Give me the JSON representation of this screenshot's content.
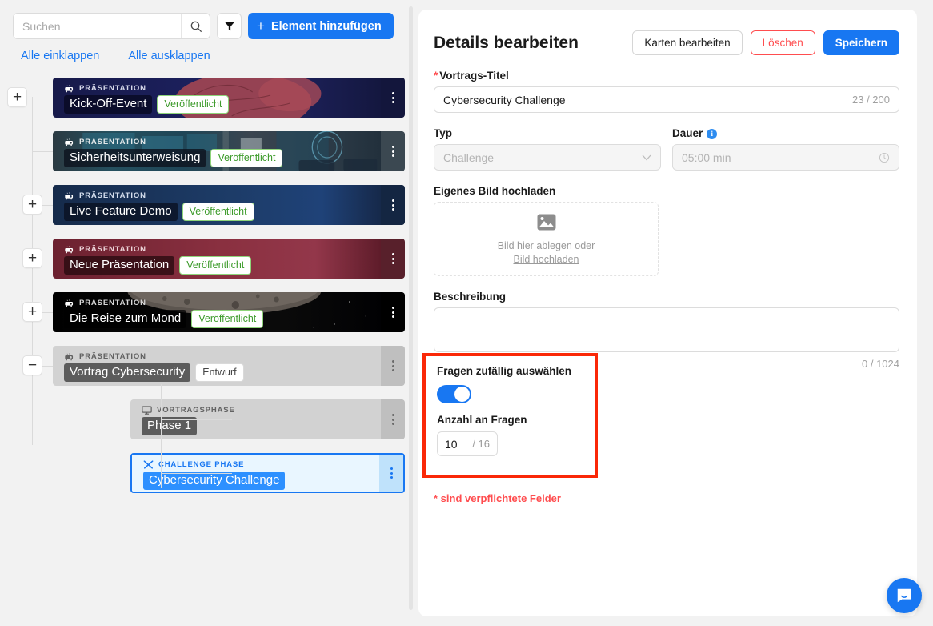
{
  "left": {
    "search": {
      "placeholder": "Suchen",
      "value": "",
      "icon": "search-icon"
    },
    "filter_icon": "filter-icon",
    "add_button": {
      "label": "Element hinzufügen",
      "icon": "plus-icon"
    },
    "collapse_all": "Alle einklappen",
    "expand_all": "Alle ausklappen",
    "tree": [
      {
        "kicker": "PRÄSENTATION",
        "kicker_icon": "projector-icon",
        "title": "Kick-Off-Event",
        "badge": "Veröffentlicht",
        "badge_type": "published",
        "toggle": "+",
        "indent": 0,
        "theme": "dark-blue-brain"
      },
      {
        "kicker": "PRÄSENTATION",
        "kicker_icon": "projector-icon",
        "title": "Sicherheitsunterweisung",
        "badge": "Veröffentlicht",
        "badge_type": "published",
        "toggle": "",
        "indent": 0,
        "theme": "teal-office"
      },
      {
        "kicker": "PRÄSENTATION",
        "kicker_icon": "projector-icon",
        "title": "Live Feature Demo",
        "badge": "Veröffentlicht",
        "badge_type": "published",
        "toggle": "+",
        "indent": 0,
        "theme": "navy"
      },
      {
        "kicker": "PRÄSENTATION",
        "kicker_icon": "projector-icon",
        "title": "Neue Präsentation",
        "badge": "Veröffentlicht",
        "badge_type": "published",
        "toggle": "+",
        "indent": 0,
        "theme": "maroon"
      },
      {
        "kicker": "PRÄSENTATION",
        "kicker_icon": "projector-icon",
        "title": "Die Reise zum Mond",
        "badge": "Veröffentlicht",
        "badge_type": "published",
        "toggle": "+",
        "indent": 0,
        "theme": "moon"
      },
      {
        "kicker": "PRÄSENTATION",
        "kicker_icon": "projector-icon",
        "title": "Vortrag Cybersecurity",
        "badge": "Entwurf",
        "badge_type": "draft",
        "toggle": "−",
        "indent": 0,
        "theme": "grey"
      },
      {
        "kicker": "VORTRAGSPHASE",
        "kicker_icon": "monitor-icon",
        "title": "Phase 1",
        "badge": "",
        "badge_type": "none",
        "toggle": "",
        "indent": 1,
        "theme": "grey"
      },
      {
        "kicker": "CHALLENGE PHASE",
        "kicker_icon": "crossed-swords-icon",
        "title": "Cybersecurity Challenge",
        "badge": "",
        "badge_type": "none",
        "toggle": "",
        "indent": 1,
        "theme": "selected-blue"
      }
    ]
  },
  "details": {
    "title": "Details bearbeiten",
    "actions": {
      "edit_cards": "Karten bearbeiten",
      "delete": "Löschen",
      "save": "Speichern"
    },
    "fields": {
      "talk_title_label": "Vortrags-Titel",
      "talk_title_required_mark": "*",
      "talk_title_value": "Cybersecurity Challenge",
      "talk_title_counter": "23 / 200",
      "type_label": "Typ",
      "type_value": "Challenge",
      "type_icon": "chevron-down-icon",
      "duration_label": "Dauer",
      "duration_info_icon": "info-icon",
      "duration_value": "05:00 min",
      "duration_icon": "clock-icon",
      "upload_label": "Eigenes Bild hochladen",
      "upload_icon": "image-icon",
      "upload_hint": "Bild hier ablegen oder",
      "upload_link": "Bild hochladen",
      "description_label": "Beschreibung",
      "description_value": "",
      "description_counter": "0 / 1024"
    },
    "random_questions": {
      "toggle_label": "Fragen zufällig auswählen",
      "toggle_on": true,
      "count_label": "Anzahl an Fragen",
      "count_value": "10",
      "count_total": "/ 16"
    },
    "required_note": "* sind verpflichtete Felder"
  },
  "chat": {
    "icon": "chat-bubble-icon"
  },
  "colors": {
    "accent": "#1877f2",
    "danger": "#ff4d4f",
    "highlight_box": "#fa2807",
    "published_text": "#3d9b2b",
    "page_bg": "#f2f2f2"
  }
}
